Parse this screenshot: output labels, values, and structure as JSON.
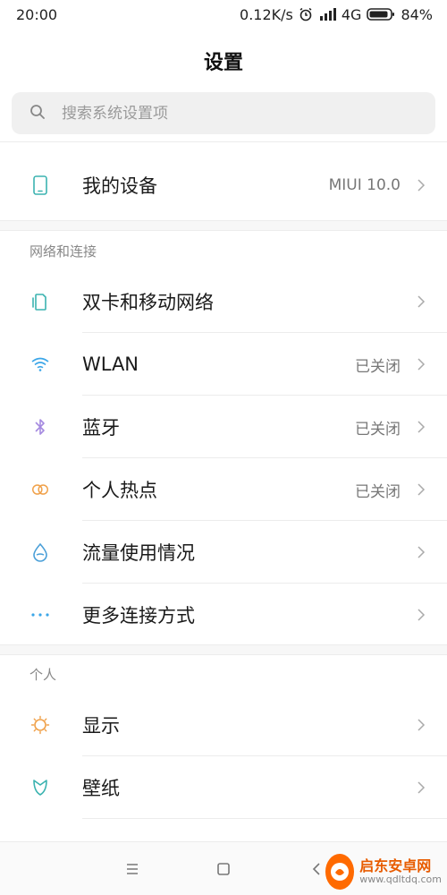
{
  "status": {
    "time": "20:00",
    "speed": "0.12K/s",
    "network": "4G",
    "battery": "84%"
  },
  "header": {
    "title": "设置"
  },
  "search": {
    "placeholder": "搜索系统设置项"
  },
  "device": {
    "label": "我的设备",
    "value": "MIUI 10.0",
    "icon": "phone-icon"
  },
  "sections": {
    "network": {
      "title": "网络和连接",
      "items": [
        {
          "label": "双卡和移动网络",
          "value": "",
          "icon": "sim-card-icon"
        },
        {
          "label": "WLAN",
          "value": "已关闭",
          "icon": "wifi-icon"
        },
        {
          "label": "蓝牙",
          "value": "已关闭",
          "icon": "bluetooth-icon"
        },
        {
          "label": "个人热点",
          "value": "已关闭",
          "icon": "hotspot-icon"
        },
        {
          "label": "流量使用情况",
          "value": "",
          "icon": "data-usage-icon"
        },
        {
          "label": "更多连接方式",
          "value": "",
          "icon": "more-dots-icon"
        }
      ]
    },
    "personal": {
      "title": "个人",
      "items": [
        {
          "label": "显示",
          "value": "",
          "icon": "brightness-icon"
        },
        {
          "label": "壁纸",
          "value": "",
          "icon": "wallpaper-icon"
        }
      ]
    }
  },
  "watermark": {
    "name": "启东安卓网",
    "url": "www.qdltdq.com"
  },
  "colors": {
    "teal": "#3bb3b0",
    "wifi": "#3ba6e8",
    "bluetooth": "#a58ae0",
    "hotspot": "#f0a14a",
    "data": "#4a9fd8",
    "display": "#f0a14a"
  }
}
